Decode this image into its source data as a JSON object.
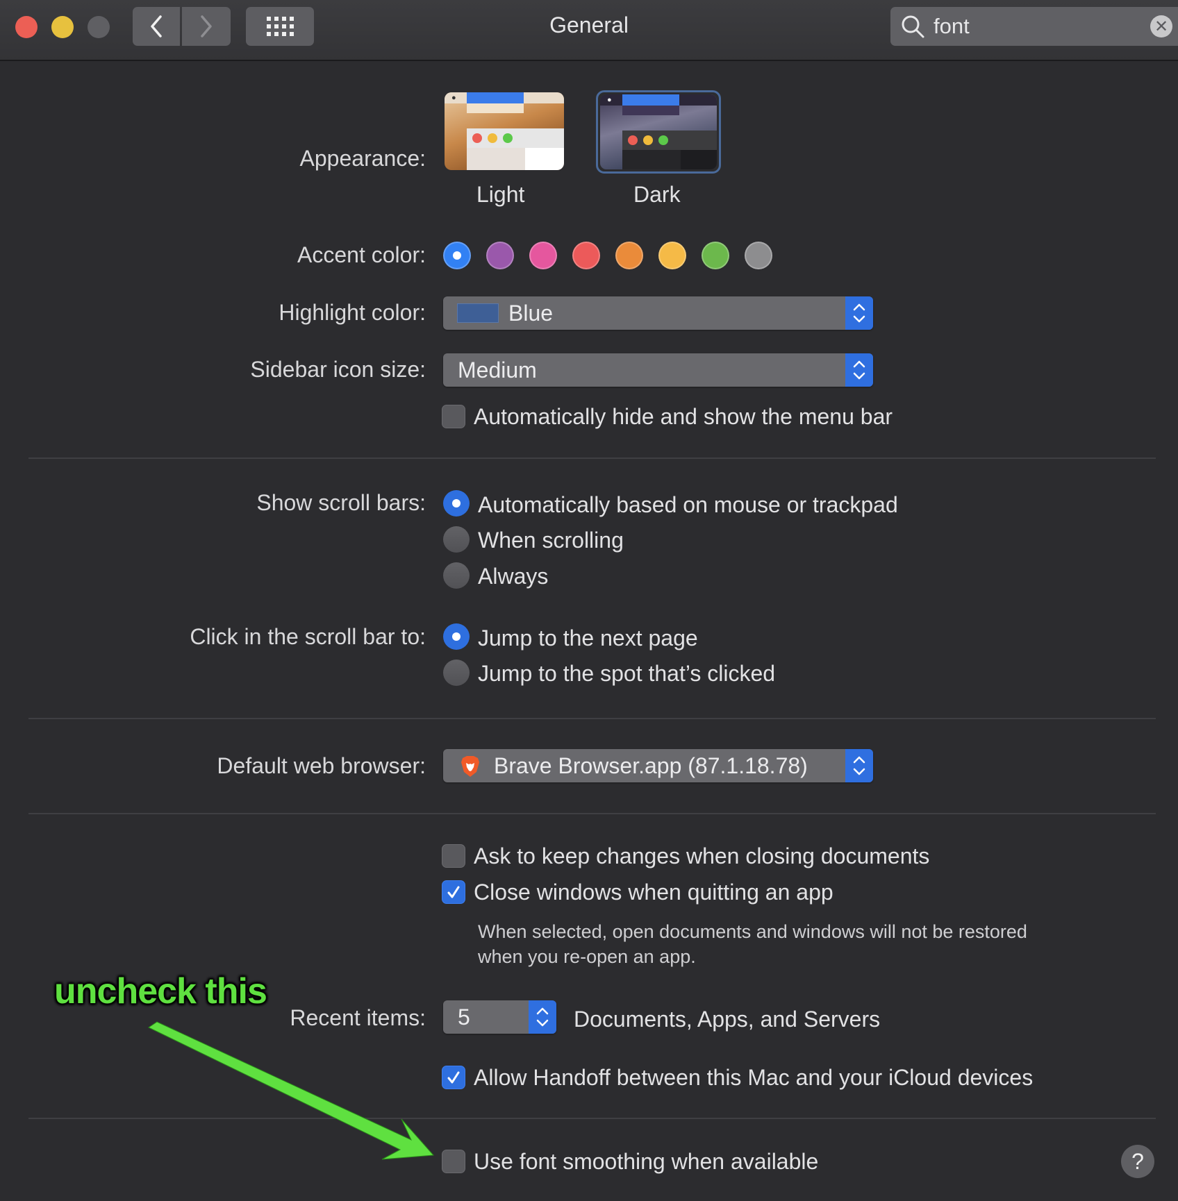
{
  "window": {
    "title": "General",
    "traffic_lights": [
      "close",
      "minimize",
      "zoom"
    ],
    "nav": {
      "back_icon": "chevron-left-icon",
      "forward_icon": "chevron-right-icon",
      "grid_icon": "show-all-grid-icon"
    },
    "search": {
      "value": "font",
      "icon": "search-icon",
      "clear_icon": "clear-icon"
    }
  },
  "appearance": {
    "label": "Appearance:",
    "options": [
      {
        "name": "Light",
        "selected": false
      },
      {
        "name": "Dark",
        "selected": true
      }
    ]
  },
  "accent": {
    "label": "Accent color:",
    "colors": [
      {
        "name": "blue",
        "hex": "#3281f4",
        "selected": true
      },
      {
        "name": "purple",
        "hex": "#9a58ab",
        "selected": false
      },
      {
        "name": "pink",
        "hex": "#e5579e",
        "selected": false
      },
      {
        "name": "red",
        "hex": "#ec5a5a",
        "selected": false
      },
      {
        "name": "orange",
        "hex": "#ea8b3a",
        "selected": false
      },
      {
        "name": "yellow",
        "hex": "#f5ba47",
        "selected": false
      },
      {
        "name": "green",
        "hex": "#6cb84c",
        "selected": false
      },
      {
        "name": "graphite",
        "hex": "#8d8d8f",
        "selected": false
      }
    ]
  },
  "highlight": {
    "label": "Highlight color:",
    "value": "Blue",
    "swatch_hex": "#3e5f96"
  },
  "sidebar_icon_size": {
    "label": "Sidebar icon size:",
    "value": "Medium"
  },
  "menu_bar": {
    "label": "Automatically hide and show the menu bar",
    "checked": false
  },
  "scroll_bars": {
    "label": "Show scroll bars:",
    "options": [
      {
        "label": "Automatically based on mouse or trackpad",
        "selected": true
      },
      {
        "label": "When scrolling",
        "selected": false
      },
      {
        "label": "Always",
        "selected": false
      }
    ]
  },
  "click_scroll": {
    "label": "Click in the scroll bar to:",
    "options": [
      {
        "label": "Jump to the next page",
        "selected": true
      },
      {
        "label": "Jump to the spot that’s clicked",
        "selected": false
      }
    ]
  },
  "browser": {
    "label": "Default web browser:",
    "value": "Brave Browser.app (87.1.18.78)",
    "icon": "brave-lion-icon"
  },
  "documents": {
    "ask_keep": {
      "label": "Ask to keep changes when closing documents",
      "checked": false
    },
    "close_windows": {
      "label": "Close windows when quitting an app",
      "checked": true
    },
    "hint_line1": "When selected, open documents and windows will not be restored",
    "hint_line2": "when you re-open an app."
  },
  "recent_items": {
    "label": "Recent items:",
    "value": "5",
    "suffix": "Documents, Apps, and Servers"
  },
  "handoff": {
    "label": "Allow Handoff between this Mac and your iCloud devices",
    "checked": true
  },
  "font_smoothing": {
    "label": "Use font smoothing when available",
    "checked": false
  },
  "help": {
    "symbol": "?"
  },
  "annotation": {
    "text": "uncheck this",
    "color": "#5fe040"
  }
}
